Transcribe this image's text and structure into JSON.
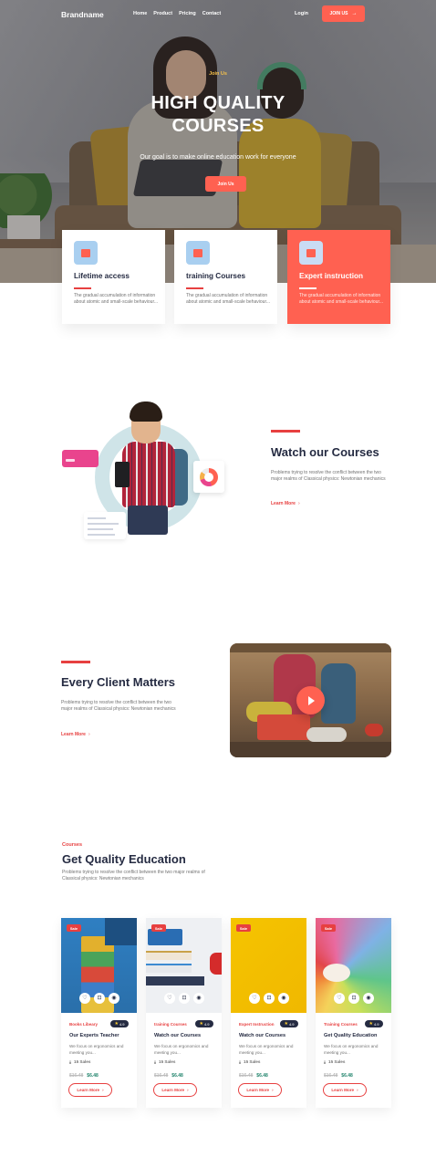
{
  "nav": {
    "brand": "Brandname",
    "links": [
      "Home",
      "Product",
      "Pricing",
      "Contact"
    ],
    "login": "Login",
    "join": "JOIN US",
    "join_icon": "arrow-right-icon"
  },
  "hero": {
    "eyebrow": "Join Us",
    "title": "HIGH QUALITY COURSES",
    "subtitle": "Our goal is to make online education work for everyone",
    "button": "Join Us"
  },
  "features": [
    {
      "title": "Lifetime access",
      "text": "The gradual accumulation of information about atomic and small-scale behaviour...",
      "icon": "monitor-icon"
    },
    {
      "title": "training Courses",
      "text": "The gradual accumulation of information about atomic and small-scale behaviour...",
      "icon": "bag-icon"
    },
    {
      "title": "Expert instruction",
      "text": "The gradual accumulation of information about atomic and small-scale behaviour...",
      "icon": "book-icon"
    }
  ],
  "watch": {
    "title": "Watch our Courses",
    "text": "Problems trying to resolve the conflict between the two major realms of Classical physics: Newtonian mechanics",
    "learn_more": "Learn More"
  },
  "client": {
    "title": "Every Client Matters",
    "text": "Problems trying to resolve the conflict between the two major realms of Classical physics: Newtonian mechanics",
    "learn_more": "Learn More"
  },
  "courses": {
    "eyebrow": "Courses",
    "title": "Get Quality Education",
    "text": "Problems trying to resolve the conflict between the two major realms of Classical physics: Newtonian mechanics",
    "items": [
      {
        "sale": "Sale",
        "category": "Books Libeary",
        "rating": "4.9",
        "title": "Our Experts Teacher",
        "desc": "We focus on ergonomics and meeting you...",
        "sales": "15 Sales",
        "old_price": "$16.48",
        "new_price": "$6.48",
        "button": "Learn More"
      },
      {
        "sale": "Sale",
        "category": "training Courses",
        "rating": "4.9",
        "title": "Watch our Courses",
        "desc": "We focus on ergonomics and meeting you...",
        "sales": "15 Sales",
        "old_price": "$16.48",
        "new_price": "$6.48",
        "button": "Learn More"
      },
      {
        "sale": "Sale",
        "category": "Expert Instruction",
        "rating": "4.9",
        "title": "Watch our Courses",
        "desc": "We focus on ergonomics and meeting you...",
        "sales": "15 Sales",
        "old_price": "$16.48",
        "new_price": "$6.48",
        "button": "Learn More"
      },
      {
        "sale": "Sale",
        "category": "Training Courses",
        "rating": "4.9",
        "title": "Get Quality Education",
        "desc": "We focus on ergonomics and meeting you...",
        "sales": "15 Sales",
        "old_price": "$16.48",
        "new_price": "$6.48",
        "button": "Learn More"
      }
    ]
  },
  "colors": {
    "accent": "#FF6151",
    "danger": "#E74040",
    "heading": "#252B42",
    "muted": "#737373",
    "price": "#23856D"
  }
}
